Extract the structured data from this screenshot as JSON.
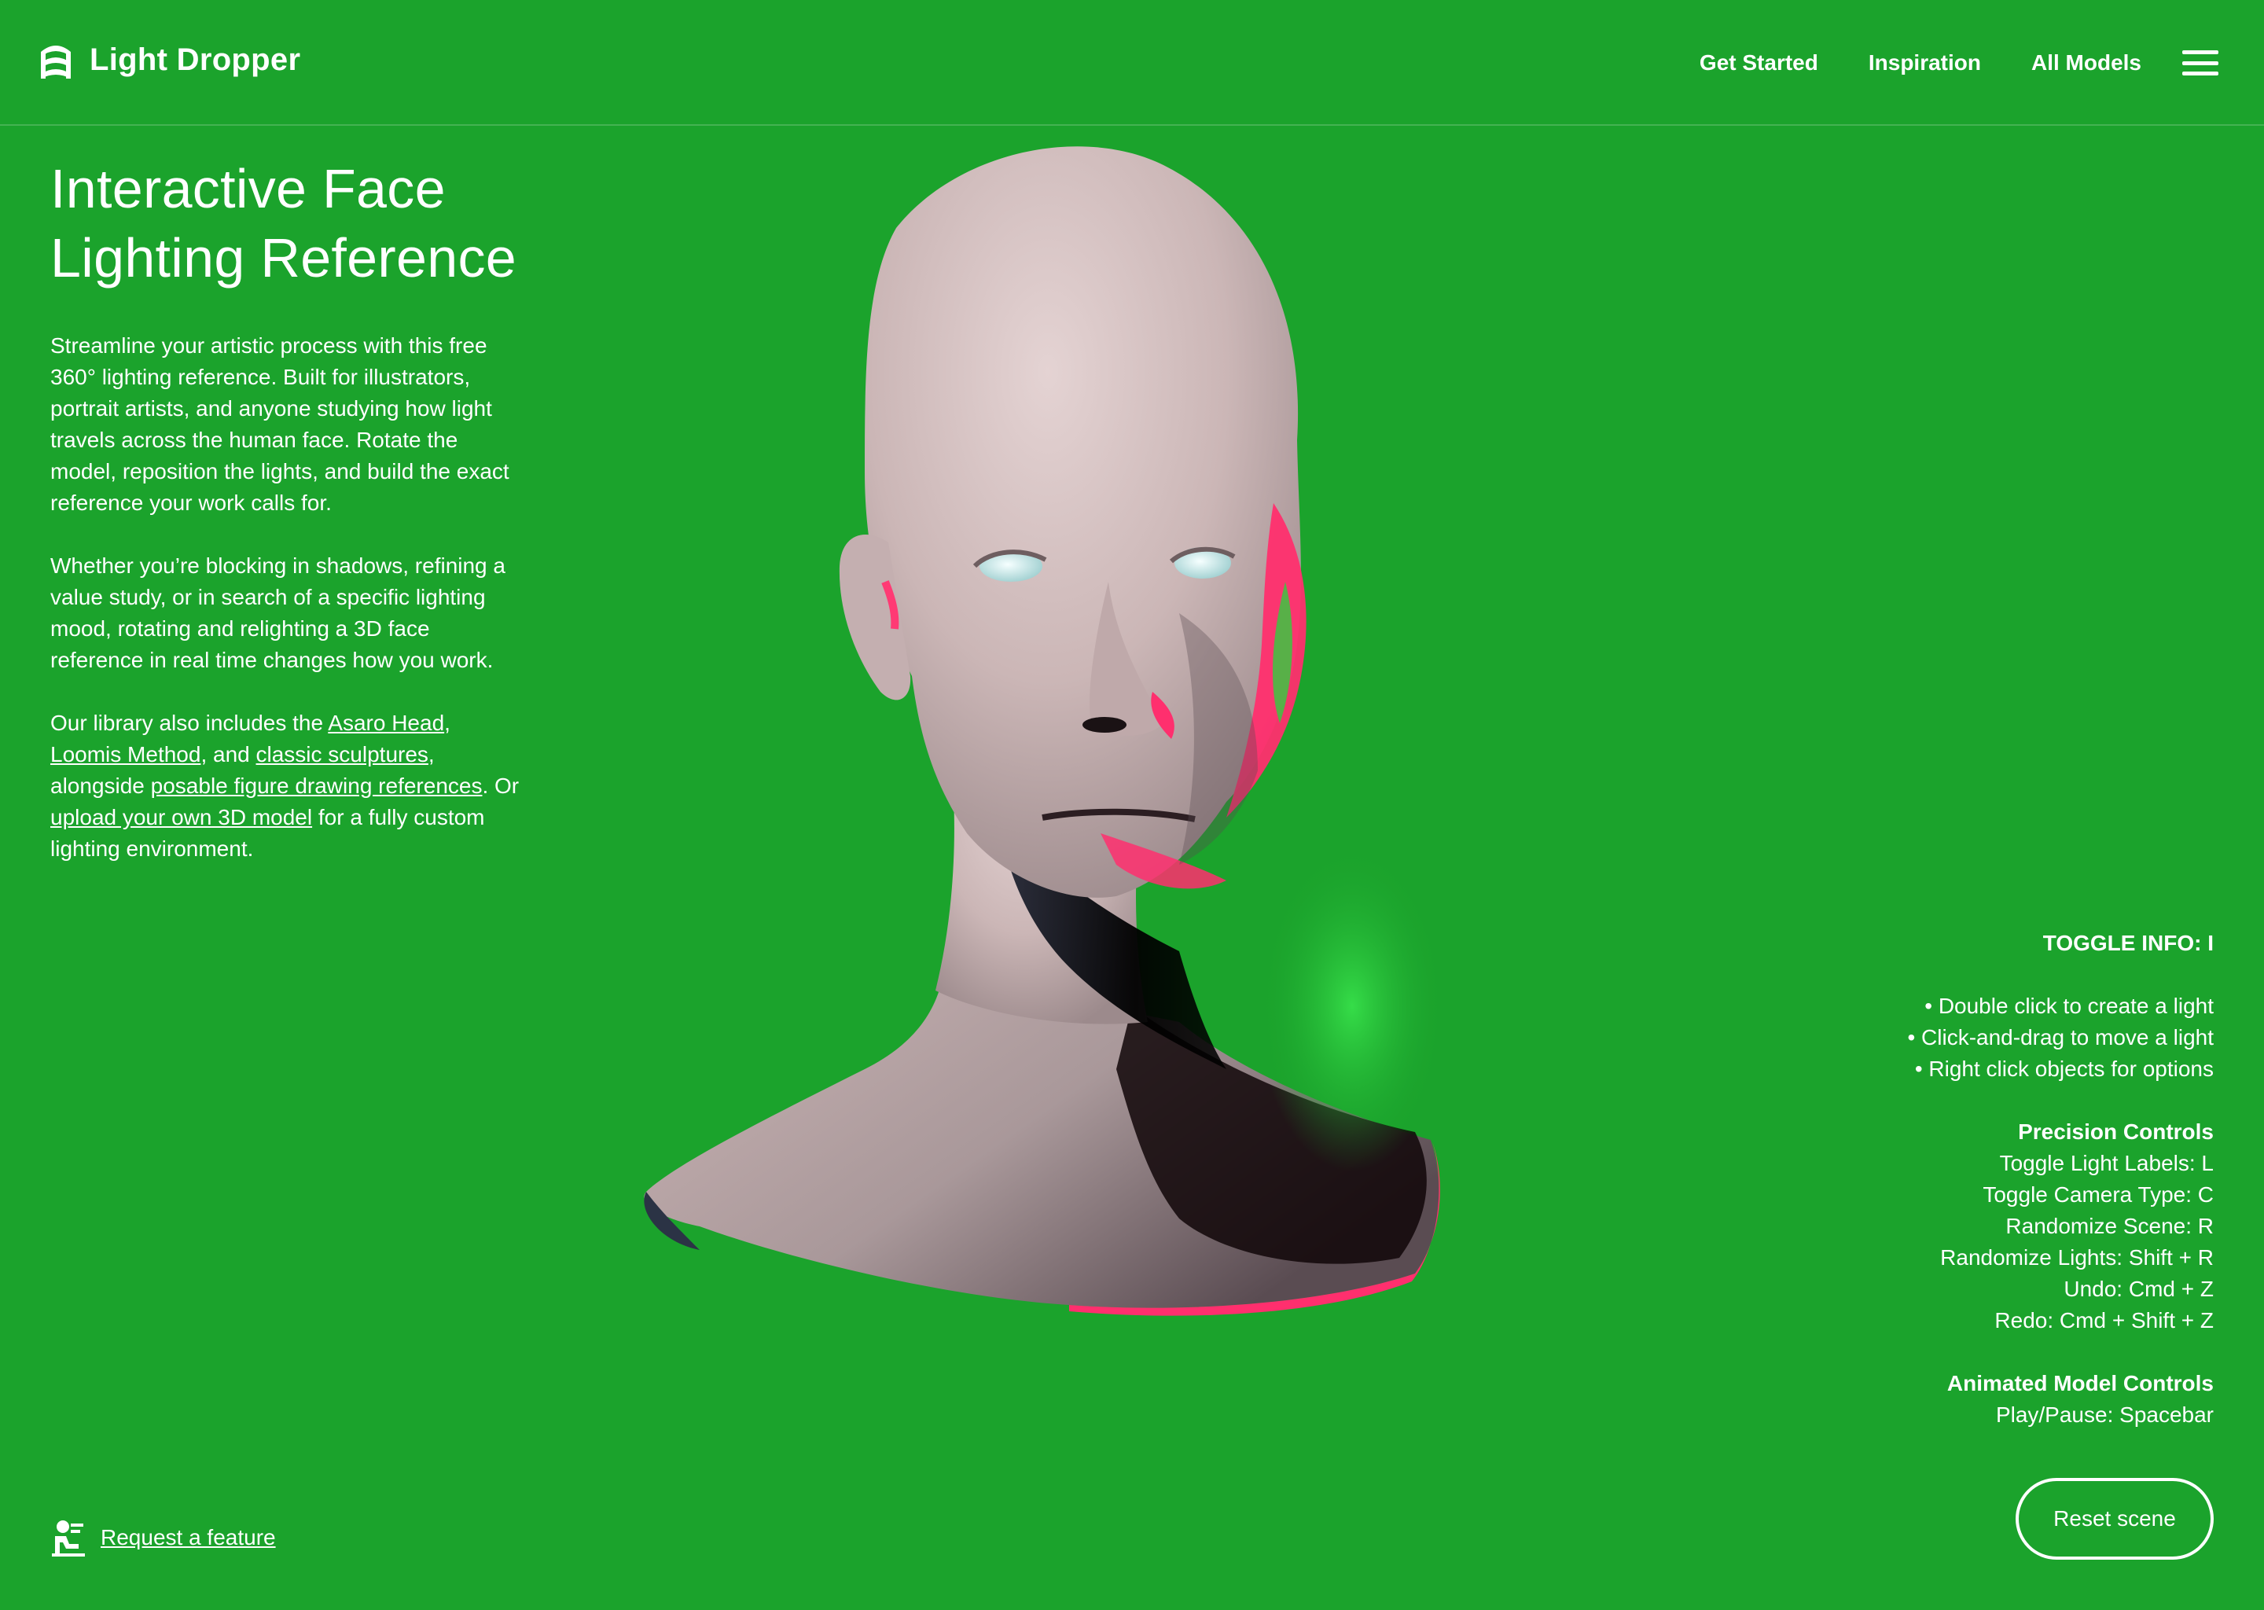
{
  "header": {
    "logo_text": "Light Dropper",
    "nav": [
      {
        "label": "Get Started"
      },
      {
        "label": "Inspiration"
      },
      {
        "label": "All Models"
      }
    ]
  },
  "intro": {
    "title_line1": "Interactive Face",
    "title_line2": "Lighting Reference",
    "p1": "Streamline your artistic process with this free 360° lighting reference. Built for illustrators, portrait artists, and anyone studying how light travels across the human face. Rotate the model, reposition the lights, and build the exact reference your work calls for.",
    "p2": "Whether you’re blocking in shadows, refining a value study, or in search of a specific lighting mood, rotating and relighting a 3D face reference in real time changes how you work.",
    "p3": {
      "t1": "Our library also includes the ",
      "link1": "Asaro Head",
      "t2": ", ",
      "link2": "Loomis Method",
      "t3": ", and ",
      "link3": "classic sculptures",
      "t4": ", alongside ",
      "link4": "posable figure drawing references",
      "t5": ". Or ",
      "link5": "upload your own 3D model",
      "t6": " for a fully custom lighting environment."
    }
  },
  "info": {
    "toggle": "TOGGLE INFO: I",
    "bullets": [
      "• Double click to create a light",
      "• Click-and-drag to move a light",
      "• Right click objects for options"
    ],
    "precision_title": "Precision Controls",
    "precision": [
      "Toggle Light Labels: L",
      "Toggle Camera Type: C",
      "Randomize Scene: R",
      "Randomize Lights: Shift + R",
      "Undo: Cmd + Z",
      "Redo: Cmd + Shift + Z"
    ],
    "animated_title": "Animated Model Controls",
    "animated": [
      "Play/Pause: Spacebar"
    ]
  },
  "reset_label": "Reset scene",
  "request_label": "Request a feature",
  "colors": {
    "background": "#1ba32c",
    "text": "#ffffff",
    "skin": "#cdb8b8",
    "rim_pink": "#ff2f6e",
    "rim_green": "#2fcf3f"
  }
}
